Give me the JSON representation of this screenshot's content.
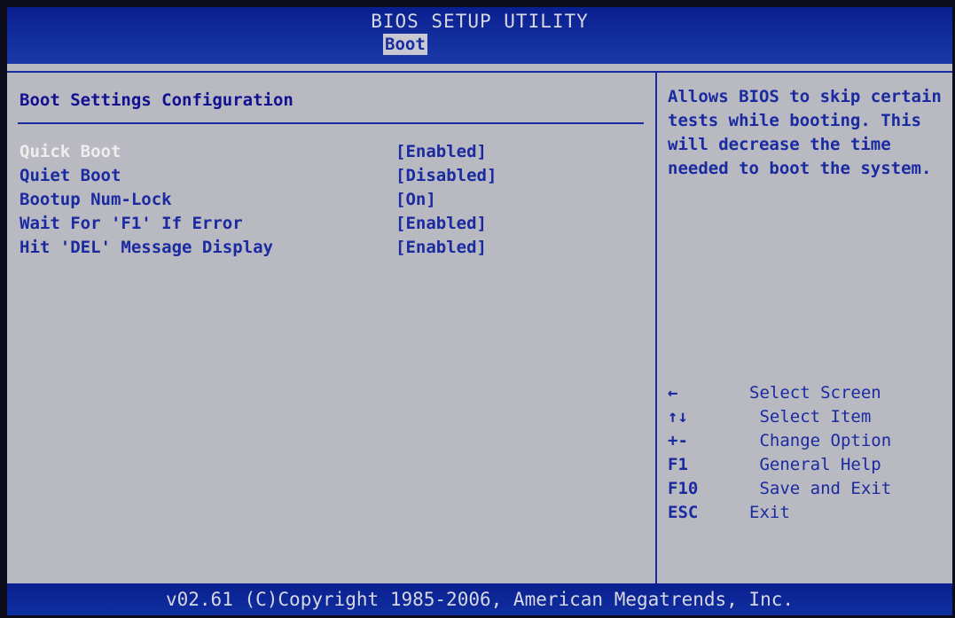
{
  "header": {
    "title": "BIOS SETUP UTILITY",
    "active_tab": "Boot"
  },
  "main": {
    "section_title": "Boot Settings Configuration",
    "settings": [
      {
        "label": "Quick Boot",
        "value": "[Enabled]",
        "selected": true
      },
      {
        "label": "Quiet Boot",
        "value": "[Disabled]",
        "selected": false
      },
      {
        "label": "Bootup Num-Lock",
        "value": "[On]",
        "selected": false
      },
      {
        "label": "Wait For 'F1' If Error",
        "value": "[Enabled]",
        "selected": false
      },
      {
        "label": "Hit 'DEL' Message Display",
        "value": "[Enabled]",
        "selected": false
      }
    ]
  },
  "help": {
    "text": "Allows BIOS to skip certain tests while booting. This will decrease the time needed to boot the system.",
    "keys": [
      {
        "key": "←",
        "desc": "Select Screen"
      },
      {
        "key": "↑↓",
        "desc": " Select Item"
      },
      {
        "key": "+-",
        "desc": " Change Option"
      },
      {
        "key": "F1",
        "desc": " General Help"
      },
      {
        "key": "F10",
        "desc": " Save and Exit"
      },
      {
        "key": "ESC",
        "desc": "Exit"
      }
    ]
  },
  "footer": {
    "text": "v02.61 (C)Copyright 1985-2006, American Megatrends, Inc."
  },
  "colors": {
    "accent": "#1a2aa0",
    "background": "#b9b9c1",
    "selected_text": "#eeeeee"
  }
}
